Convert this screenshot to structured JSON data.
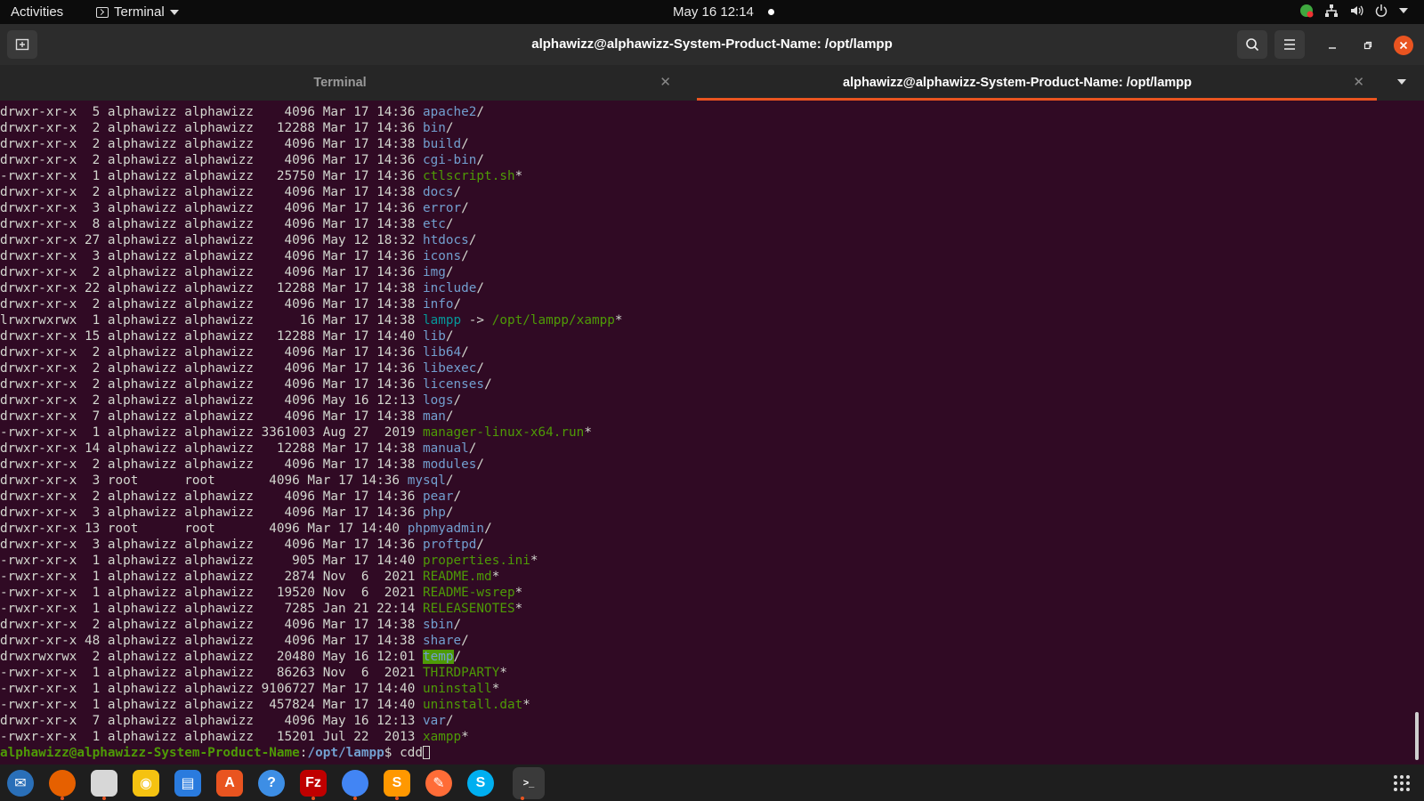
{
  "topbar": {
    "activities": "Activities",
    "app_name": "Terminal",
    "datetime": "May 16  12:14"
  },
  "window": {
    "title": "alphawizz@alphawizz-System-Product-Name: /opt/lampp"
  },
  "tabs": [
    {
      "label": "Terminal",
      "active": false
    },
    {
      "label": "alphawizz@alphawizz-System-Product-Name: /opt/lampp",
      "active": true
    }
  ],
  "colors": {
    "accent": "#e95420",
    "terminal_bg": "#300a24",
    "dir": "#729fcf",
    "exe": "#4e9a06"
  },
  "listing": [
    {
      "meta": "drwxr-xr-x  5 alphawizz alphawizz    4096 Mar 17 14:36 ",
      "name": "apache2",
      "type": "dir",
      "suffix": "/"
    },
    {
      "meta": "drwxr-xr-x  2 alphawizz alphawizz   12288 Mar 17 14:36 ",
      "name": "bin",
      "type": "dir",
      "suffix": "/"
    },
    {
      "meta": "drwxr-xr-x  2 alphawizz alphawizz    4096 Mar 17 14:38 ",
      "name": "build",
      "type": "dir",
      "suffix": "/"
    },
    {
      "meta": "drwxr-xr-x  2 alphawizz alphawizz    4096 Mar 17 14:36 ",
      "name": "cgi-bin",
      "type": "dir",
      "suffix": "/"
    },
    {
      "meta": "-rwxr-xr-x  1 alphawizz alphawizz   25750 Mar 17 14:36 ",
      "name": "ctlscript.sh",
      "type": "exe",
      "suffix": "*"
    },
    {
      "meta": "drwxr-xr-x  2 alphawizz alphawizz    4096 Mar 17 14:38 ",
      "name": "docs",
      "type": "dir",
      "suffix": "/"
    },
    {
      "meta": "drwxr-xr-x  3 alphawizz alphawizz    4096 Mar 17 14:36 ",
      "name": "error",
      "type": "dir",
      "suffix": "/"
    },
    {
      "meta": "drwxr-xr-x  8 alphawizz alphawizz    4096 Mar 17 14:38 ",
      "name": "etc",
      "type": "dir",
      "suffix": "/"
    },
    {
      "meta": "drwxr-xr-x 27 alphawizz alphawizz    4096 May 12 18:32 ",
      "name": "htdocs",
      "type": "dir",
      "suffix": "/"
    },
    {
      "meta": "drwxr-xr-x  3 alphawizz alphawizz    4096 Mar 17 14:36 ",
      "name": "icons",
      "type": "dir",
      "suffix": "/"
    },
    {
      "meta": "drwxr-xr-x  2 alphawizz alphawizz    4096 Mar 17 14:36 ",
      "name": "img",
      "type": "dir",
      "suffix": "/"
    },
    {
      "meta": "drwxr-xr-x 22 alphawizz alphawizz   12288 Mar 17 14:38 ",
      "name": "include",
      "type": "dir",
      "suffix": "/"
    },
    {
      "meta": "drwxr-xr-x  2 alphawizz alphawizz    4096 Mar 17 14:38 ",
      "name": "info",
      "type": "dir",
      "suffix": "/"
    },
    {
      "meta": "lrwxrwxrwx  1 alphawizz alphawizz      16 Mar 17 14:38 ",
      "name": "lampp",
      "type": "link",
      "suffix": " -> ",
      "target": "/opt/lampp/xampp",
      "target_suffix": "*"
    },
    {
      "meta": "drwxr-xr-x 15 alphawizz alphawizz   12288 Mar 17 14:40 ",
      "name": "lib",
      "type": "dir",
      "suffix": "/"
    },
    {
      "meta": "drwxr-xr-x  2 alphawizz alphawizz    4096 Mar 17 14:36 ",
      "name": "lib64",
      "type": "dir",
      "suffix": "/"
    },
    {
      "meta": "drwxr-xr-x  2 alphawizz alphawizz    4096 Mar 17 14:36 ",
      "name": "libexec",
      "type": "dir",
      "suffix": "/"
    },
    {
      "meta": "drwxr-xr-x  2 alphawizz alphawizz    4096 Mar 17 14:36 ",
      "name": "licenses",
      "type": "dir",
      "suffix": "/"
    },
    {
      "meta": "drwxr-xr-x  2 alphawizz alphawizz    4096 May 16 12:13 ",
      "name": "logs",
      "type": "dir",
      "suffix": "/"
    },
    {
      "meta": "drwxr-xr-x  7 alphawizz alphawizz    4096 Mar 17 14:38 ",
      "name": "man",
      "type": "dir",
      "suffix": "/"
    },
    {
      "meta": "-rwxr-xr-x  1 alphawizz alphawizz 3361003 Aug 27  2019 ",
      "name": "manager-linux-x64.run",
      "type": "exe",
      "suffix": "*"
    },
    {
      "meta": "drwxr-xr-x 14 alphawizz alphawizz   12288 Mar 17 14:38 ",
      "name": "manual",
      "type": "dir",
      "suffix": "/"
    },
    {
      "meta": "drwxr-xr-x  2 alphawizz alphawizz    4096 Mar 17 14:38 ",
      "name": "modules",
      "type": "dir",
      "suffix": "/"
    },
    {
      "meta": "drwxr-xr-x  3 root      root       4096 Mar 17 14:36 ",
      "name": "mysql",
      "type": "dir",
      "suffix": "/"
    },
    {
      "meta": "drwxr-xr-x  2 alphawizz alphawizz    4096 Mar 17 14:36 ",
      "name": "pear",
      "type": "dir",
      "suffix": "/"
    },
    {
      "meta": "drwxr-xr-x  3 alphawizz alphawizz    4096 Mar 17 14:36 ",
      "name": "php",
      "type": "dir",
      "suffix": "/"
    },
    {
      "meta": "drwxr-xr-x 13 root      root       4096 Mar 17 14:40 ",
      "name": "phpmyadmin",
      "type": "dir",
      "suffix": "/"
    },
    {
      "meta": "drwxr-xr-x  3 alphawizz alphawizz    4096 Mar 17 14:36 ",
      "name": "proftpd",
      "type": "dir",
      "suffix": "/"
    },
    {
      "meta": "-rwxr-xr-x  1 alphawizz alphawizz     905 Mar 17 14:40 ",
      "name": "properties.ini",
      "type": "exe",
      "suffix": "*"
    },
    {
      "meta": "-rwxr-xr-x  1 alphawizz alphawizz    2874 Nov  6  2021 ",
      "name": "README.md",
      "type": "exe",
      "suffix": "*"
    },
    {
      "meta": "-rwxr-xr-x  1 alphawizz alphawizz   19520 Nov  6  2021 ",
      "name": "README-wsrep",
      "type": "exe",
      "suffix": "*"
    },
    {
      "meta": "-rwxr-xr-x  1 alphawizz alphawizz    7285 Jan 21 22:14 ",
      "name": "RELEASENOTES",
      "type": "exe",
      "suffix": "*"
    },
    {
      "meta": "drwxr-xr-x  2 alphawizz alphawizz    4096 Mar 17 14:38 ",
      "name": "sbin",
      "type": "dir",
      "suffix": "/"
    },
    {
      "meta": "drwxr-xr-x 48 alphawizz alphawizz    4096 Mar 17 14:38 ",
      "name": "share",
      "type": "dir",
      "suffix": "/"
    },
    {
      "meta": "drwxrwxrwx  2 alphawizz alphawizz   20480 May 16 12:01 ",
      "name": "temp",
      "type": "hl",
      "suffix": "/"
    },
    {
      "meta": "-rwxr-xr-x  1 alphawizz alphawizz   86263 Nov  6  2021 ",
      "name": "THIRDPARTY",
      "type": "exe",
      "suffix": "*"
    },
    {
      "meta": "-rwxr-xr-x  1 alphawizz alphawizz 9106727 Mar 17 14:40 ",
      "name": "uninstall",
      "type": "exe",
      "suffix": "*"
    },
    {
      "meta": "-rwxr-xr-x  1 alphawizz alphawizz  457824 Mar 17 14:40 ",
      "name": "uninstall.dat",
      "type": "exe",
      "suffix": "*"
    },
    {
      "meta": "drwxr-xr-x  7 alphawizz alphawizz    4096 May 16 12:13 ",
      "name": "var",
      "type": "dir",
      "suffix": "/"
    },
    {
      "meta": "-rwxr-xr-x  1 alphawizz alphawizz   15201 Jul 22  2013 ",
      "name": "xampp",
      "type": "exe",
      "suffix": "*"
    }
  ],
  "prompt": {
    "user_host": "alphawizz@alphawizz-System-Product-Name",
    "colon": ":",
    "path": "/opt/lampp",
    "symbol": "$ ",
    "command": "cdd"
  },
  "dock": [
    {
      "name": "thunderbird",
      "icon": "thunderbird-icon",
      "color": "#2a6fb8",
      "glyph": "✉",
      "running": false
    },
    {
      "name": "firefox",
      "icon": "firefox-icon",
      "color": "#e66000",
      "glyph": "",
      "running": true
    },
    {
      "name": "files",
      "icon": "files-icon",
      "color": "#d7d7d7",
      "glyph": "",
      "running": true
    },
    {
      "name": "rhythmbox",
      "icon": "rhythmbox-icon",
      "color": "#f5c211",
      "glyph": "◉",
      "running": false
    },
    {
      "name": "writer",
      "icon": "writer-icon",
      "color": "#2a7bde",
      "glyph": "▤",
      "running": false
    },
    {
      "name": "software",
      "icon": "software-icon",
      "color": "#e95420",
      "glyph": "A",
      "running": false
    },
    {
      "name": "help",
      "icon": "help-icon",
      "color": "#3d8ee5",
      "glyph": "?",
      "running": false
    },
    {
      "name": "filezilla",
      "icon": "filezilla-icon",
      "color": "#bf0000",
      "glyph": "Fz",
      "running": true
    },
    {
      "name": "chrome",
      "icon": "chrome-icon",
      "color": "#4285f4",
      "glyph": "",
      "running": true
    },
    {
      "name": "sublime",
      "icon": "sublime-icon",
      "color": "#ff9800",
      "glyph": "S",
      "running": true
    },
    {
      "name": "postman",
      "icon": "postman-icon",
      "color": "#ff6c37",
      "glyph": "✎",
      "running": false
    },
    {
      "name": "skype",
      "icon": "skype-icon",
      "color": "#00aff0",
      "glyph": "S",
      "running": false
    },
    {
      "name": "terminal",
      "icon": "terminal-icon",
      "color": "#2c2c2c",
      "glyph": ">_",
      "running": true
    }
  ]
}
